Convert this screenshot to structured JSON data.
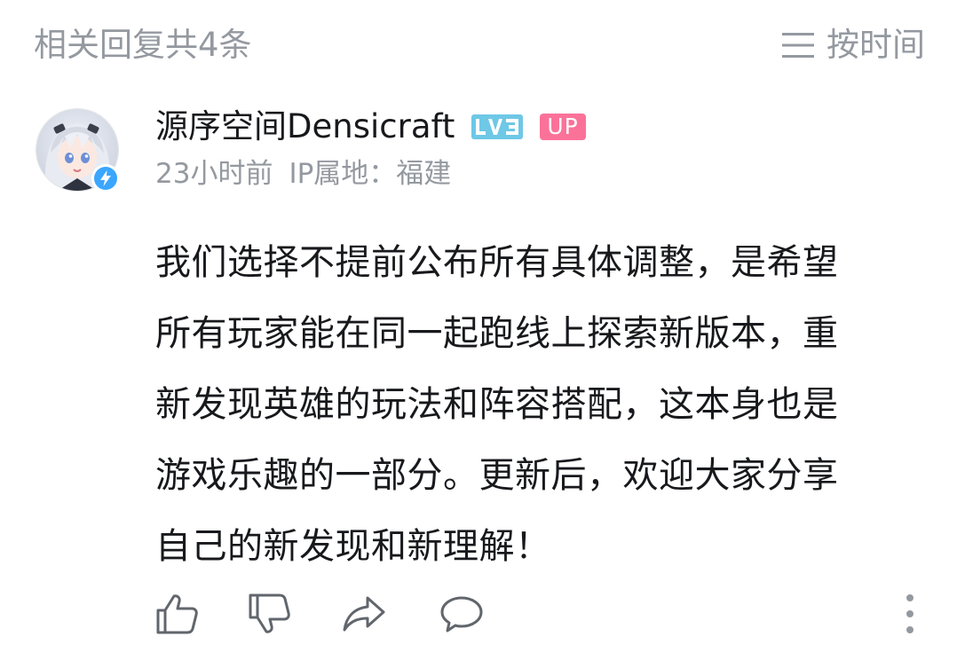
{
  "header": {
    "title": "相关回复共4条",
    "sort_label": "按时间",
    "sort_icon": "menu-lines-icon"
  },
  "comment": {
    "username": "源序空间Densicraft",
    "level": "LV3",
    "level_color": "#6ec8e6",
    "up_badge": "UP",
    "up_color": "#fb7299",
    "time": "23小时前",
    "ip_location": "IP属地：福建",
    "content_lines": [
      "我们选择不提前公布所有具体调整，是希望",
      "所有玩家能在同一起跑线上探索新版本，重",
      "新发现英雄的玩法和阵容搭配，这本身也是",
      "游戏乐趣的一部分。更新后，欢迎大家分享",
      "自己的新发现和新理解！"
    ],
    "verified_color": "#3aa6ff",
    "actions": [
      "thumb-up-icon",
      "thumb-down-icon",
      "share-icon",
      "comment-icon",
      "more-vertical-icon"
    ]
  }
}
